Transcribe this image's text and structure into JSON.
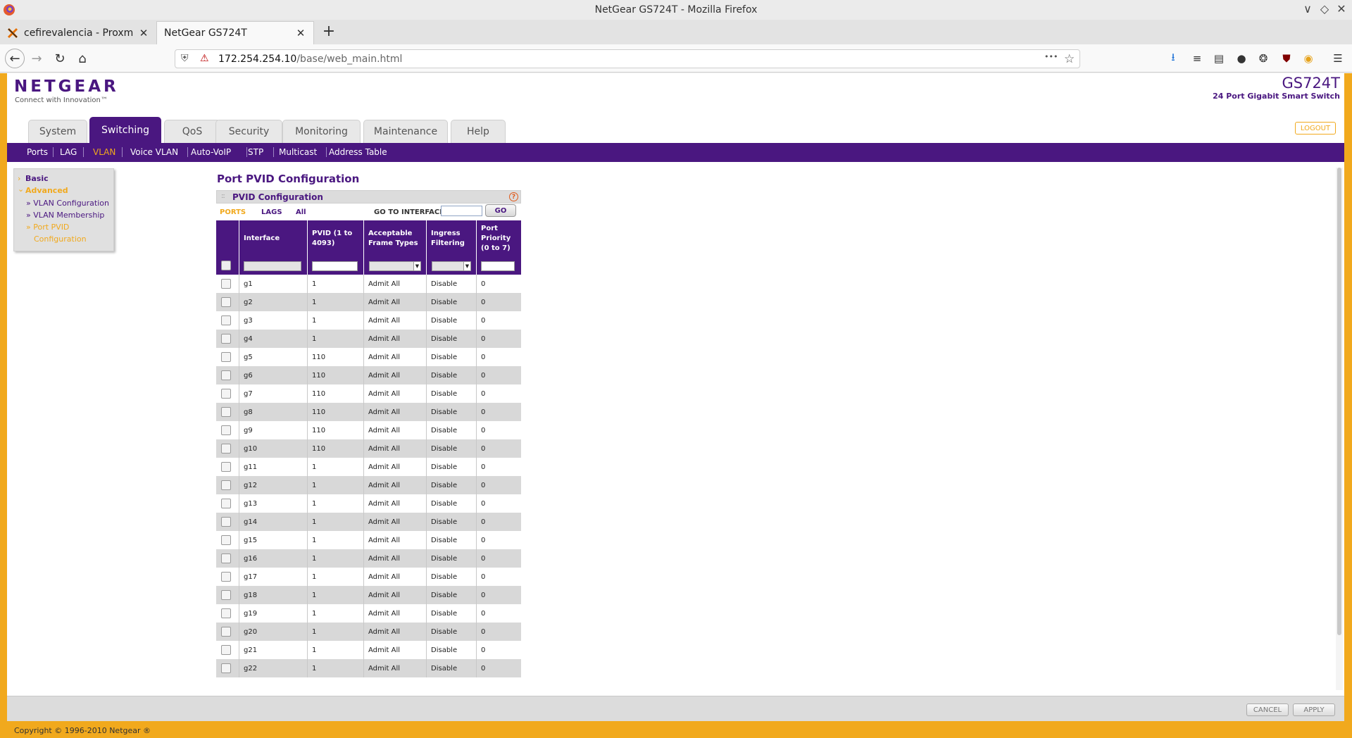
{
  "window": {
    "title": "NetGear GS724T - Mozilla Firefox",
    "controls": {
      "minimize": "∨",
      "restore": "◇",
      "close": "✕"
    }
  },
  "browser_tabs": [
    {
      "label": "cefirevalencia - Proxmox V",
      "active": false,
      "icon": "proxmox-icon"
    },
    {
      "label": "NetGear GS724T",
      "active": true,
      "icon": ""
    }
  ],
  "navbar": {
    "url_host": "172.254.254.10",
    "url_path": "/base/web_main.html",
    "icons": [
      "back-icon",
      "forward-icon",
      "reload-icon",
      "home-icon",
      "shield-icon",
      "insecure-lock-icon",
      "page-actions-icon",
      "bookmark-star-icon",
      "downloads-icon",
      "library-icon",
      "sidebar-icon",
      "account-icon",
      "extension-icon",
      "ublock-icon",
      "cookie-icon",
      "menu-icon"
    ],
    "symbols": {
      "back": "←",
      "forward": "→",
      "reload": "↻",
      "home": "⌂",
      "shield": "⛨",
      "insecure": "⚠",
      "more": "•••",
      "star": "☆",
      "download": "⭳",
      "library": "≡",
      "sidebar": "▤",
      "account": "●",
      "extension": "❂",
      "ublock": "⛊",
      "cookie": "◉",
      "menu": "☰"
    },
    "colors": {
      "download": "#1a6fd6",
      "ublock": "#800000",
      "cookie": "#e6a21a"
    }
  },
  "header": {
    "brand": "NETGEAR",
    "brand_tagline": "Connect with Innovation™",
    "model": "GS724T",
    "model_description": "24 Port Gigabit Smart Switch",
    "logout_label": "LOGOUT"
  },
  "main_tabs": [
    {
      "label": "System",
      "active": false
    },
    {
      "label": "Switching",
      "active": true
    },
    {
      "label": "QoS",
      "active": false
    },
    {
      "label": "Security",
      "active": false
    },
    {
      "label": "Monitoring",
      "active": false
    },
    {
      "label": "Maintenance",
      "active": false
    },
    {
      "label": "Help",
      "active": false
    }
  ],
  "sub_nav": [
    {
      "label": "Ports",
      "active": false
    },
    {
      "label": "LAG",
      "active": false
    },
    {
      "label": "VLAN",
      "active": true
    },
    {
      "label": "Voice VLAN",
      "active": false
    },
    {
      "label": "Auto-VoIP",
      "active": false
    },
    {
      "label": "STP",
      "active": false
    },
    {
      "label": "Multicast",
      "active": false
    },
    {
      "label": "Address Table",
      "active": false
    }
  ],
  "left_nav": {
    "basic": "Basic",
    "advanced": "Advanced",
    "items": [
      "» VLAN Configuration",
      "» VLAN Membership",
      "» Port PVID",
      "Configuration"
    ],
    "bullet": "»",
    "collapsed_marker": "›",
    "expanded_marker": "⌄"
  },
  "content": {
    "page_title": "Port PVID Configuration",
    "panel_title": "PVID Configuration",
    "panel_grip": "::",
    "help_glyph": "?",
    "filter_links": [
      {
        "label": "PORTS",
        "active": true
      },
      {
        "label": "LAGS",
        "active": false
      },
      {
        "label": "All",
        "active": false
      }
    ],
    "goto_label": "GO TO INTERFACE",
    "goto_value": "",
    "go_button": "GO",
    "columns": [
      "Interface",
      "PVID (1 to 4093)",
      "Acceptable Frame Types",
      "Ingress Filtering",
      "Port Priority (0 to 7)"
    ],
    "select_arrow": "▼",
    "rows": [
      {
        "interface": "g1",
        "pvid": "1",
        "frame_types": "Admit All",
        "ingress": "Disable",
        "priority": "0"
      },
      {
        "interface": "g2",
        "pvid": "1",
        "frame_types": "Admit All",
        "ingress": "Disable",
        "priority": "0"
      },
      {
        "interface": "g3",
        "pvid": "1",
        "frame_types": "Admit All",
        "ingress": "Disable",
        "priority": "0"
      },
      {
        "interface": "g4",
        "pvid": "1",
        "frame_types": "Admit All",
        "ingress": "Disable",
        "priority": "0"
      },
      {
        "interface": "g5",
        "pvid": "110",
        "frame_types": "Admit All",
        "ingress": "Disable",
        "priority": "0"
      },
      {
        "interface": "g6",
        "pvid": "110",
        "frame_types": "Admit All",
        "ingress": "Disable",
        "priority": "0"
      },
      {
        "interface": "g7",
        "pvid": "110",
        "frame_types": "Admit All",
        "ingress": "Disable",
        "priority": "0"
      },
      {
        "interface": "g8",
        "pvid": "110",
        "frame_types": "Admit All",
        "ingress": "Disable",
        "priority": "0"
      },
      {
        "interface": "g9",
        "pvid": "110",
        "frame_types": "Admit All",
        "ingress": "Disable",
        "priority": "0"
      },
      {
        "interface": "g10",
        "pvid": "110",
        "frame_types": "Admit All",
        "ingress": "Disable",
        "priority": "0"
      },
      {
        "interface": "g11",
        "pvid": "1",
        "frame_types": "Admit All",
        "ingress": "Disable",
        "priority": "0"
      },
      {
        "interface": "g12",
        "pvid": "1",
        "frame_types": "Admit All",
        "ingress": "Disable",
        "priority": "0"
      },
      {
        "interface": "g13",
        "pvid": "1",
        "frame_types": "Admit All",
        "ingress": "Disable",
        "priority": "0"
      },
      {
        "interface": "g14",
        "pvid": "1",
        "frame_types": "Admit All",
        "ingress": "Disable",
        "priority": "0"
      },
      {
        "interface": "g15",
        "pvid": "1",
        "frame_types": "Admit All",
        "ingress": "Disable",
        "priority": "0"
      },
      {
        "interface": "g16",
        "pvid": "1",
        "frame_types": "Admit All",
        "ingress": "Disable",
        "priority": "0"
      },
      {
        "interface": "g17",
        "pvid": "1",
        "frame_types": "Admit All",
        "ingress": "Disable",
        "priority": "0"
      },
      {
        "interface": "g18",
        "pvid": "1",
        "frame_types": "Admit All",
        "ingress": "Disable",
        "priority": "0"
      },
      {
        "interface": "g19",
        "pvid": "1",
        "frame_types": "Admit All",
        "ingress": "Disable",
        "priority": "0"
      },
      {
        "interface": "g20",
        "pvid": "1",
        "frame_types": "Admit All",
        "ingress": "Disable",
        "priority": "0"
      },
      {
        "interface": "g21",
        "pvid": "1",
        "frame_types": "Admit All",
        "ingress": "Disable",
        "priority": "0"
      },
      {
        "interface": "g22",
        "pvid": "1",
        "frame_types": "Admit All",
        "ingress": "Disable",
        "priority": "0"
      }
    ]
  },
  "footer": {
    "cancel_label": "CANCEL",
    "apply_label": "APPLY",
    "copyright": "Copyright © 1996-2010 Netgear ®"
  },
  "colors": {
    "brand_purple": "#4a1780",
    "accent_orange": "#f1a91d",
    "row_alt": "#d8d8d8"
  }
}
